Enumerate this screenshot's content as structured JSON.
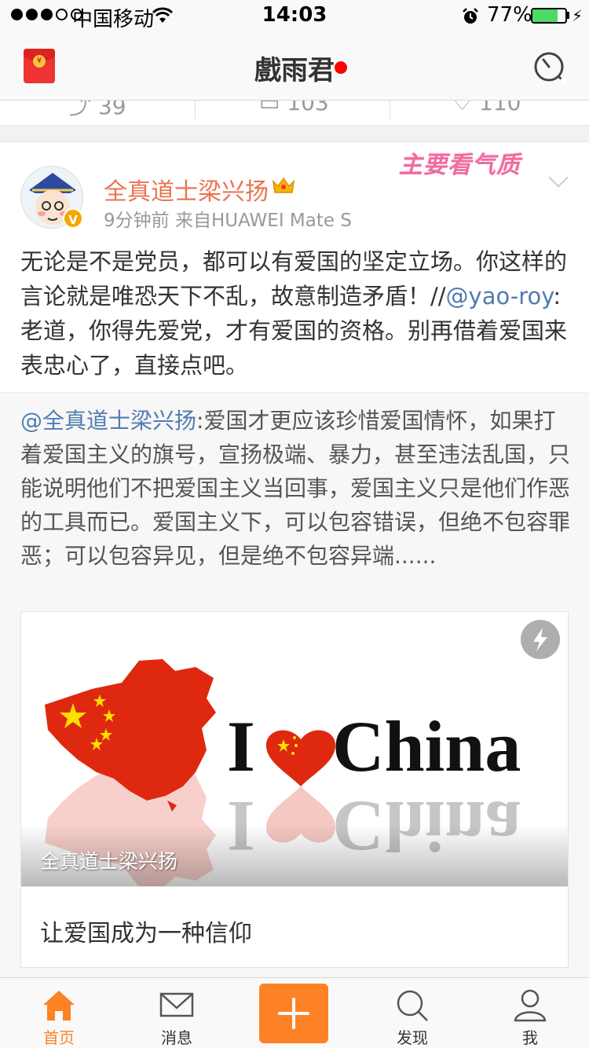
{
  "status_bar": {
    "carrier": "中国移动",
    "time": "14:03",
    "battery": "77%",
    "battery_level": 0.77
  },
  "nav": {
    "title": "戲雨君"
  },
  "prev_post": {
    "reposts": "39",
    "comments": "103",
    "likes": "110"
  },
  "post": {
    "author": "全真道士梁兴扬",
    "meta": "9分钟前  来自HUAWEI Mate S",
    "sticker": "主要看气质",
    "text_main": "无论是不是党员，都可以有爱国的坚定立场。你这样的言论就是唯恐天下不乱，故意制造矛盾！//",
    "text_mention": "@yao-roy",
    "text_tail": ":老道，你得先爱党，才有爱国的资格。别再借着爱国来表忠心了，直接点吧。"
  },
  "repost": {
    "mention": "@全真道士梁兴扬",
    "text": ":爱国才更应该珍惜爱国情怀，如果打着爱国主义的旗号，宣扬极端、暴力，甚至违法乱国，只能说明他们不把爱国主义当回事，爱国主义只是他们作恶的工具而已。爱国主义下，可以包容错误，但绝不包容罪恶；可以包容异见，但是绝不包容异端......",
    "image_text_left": "I",
    "image_text_right": "China",
    "image_caption": "全真道士梁兴扬",
    "link_title": "让爱国成为一种信仰"
  },
  "tab_bar": {
    "home": "首页",
    "messages": "消息",
    "discover": "发现",
    "me": "我"
  },
  "colors": {
    "accent": "#fd8225",
    "author": "#eb7350",
    "mention": "#507daf",
    "flag_red": "#de2910",
    "flag_yellow": "#ffde00"
  }
}
